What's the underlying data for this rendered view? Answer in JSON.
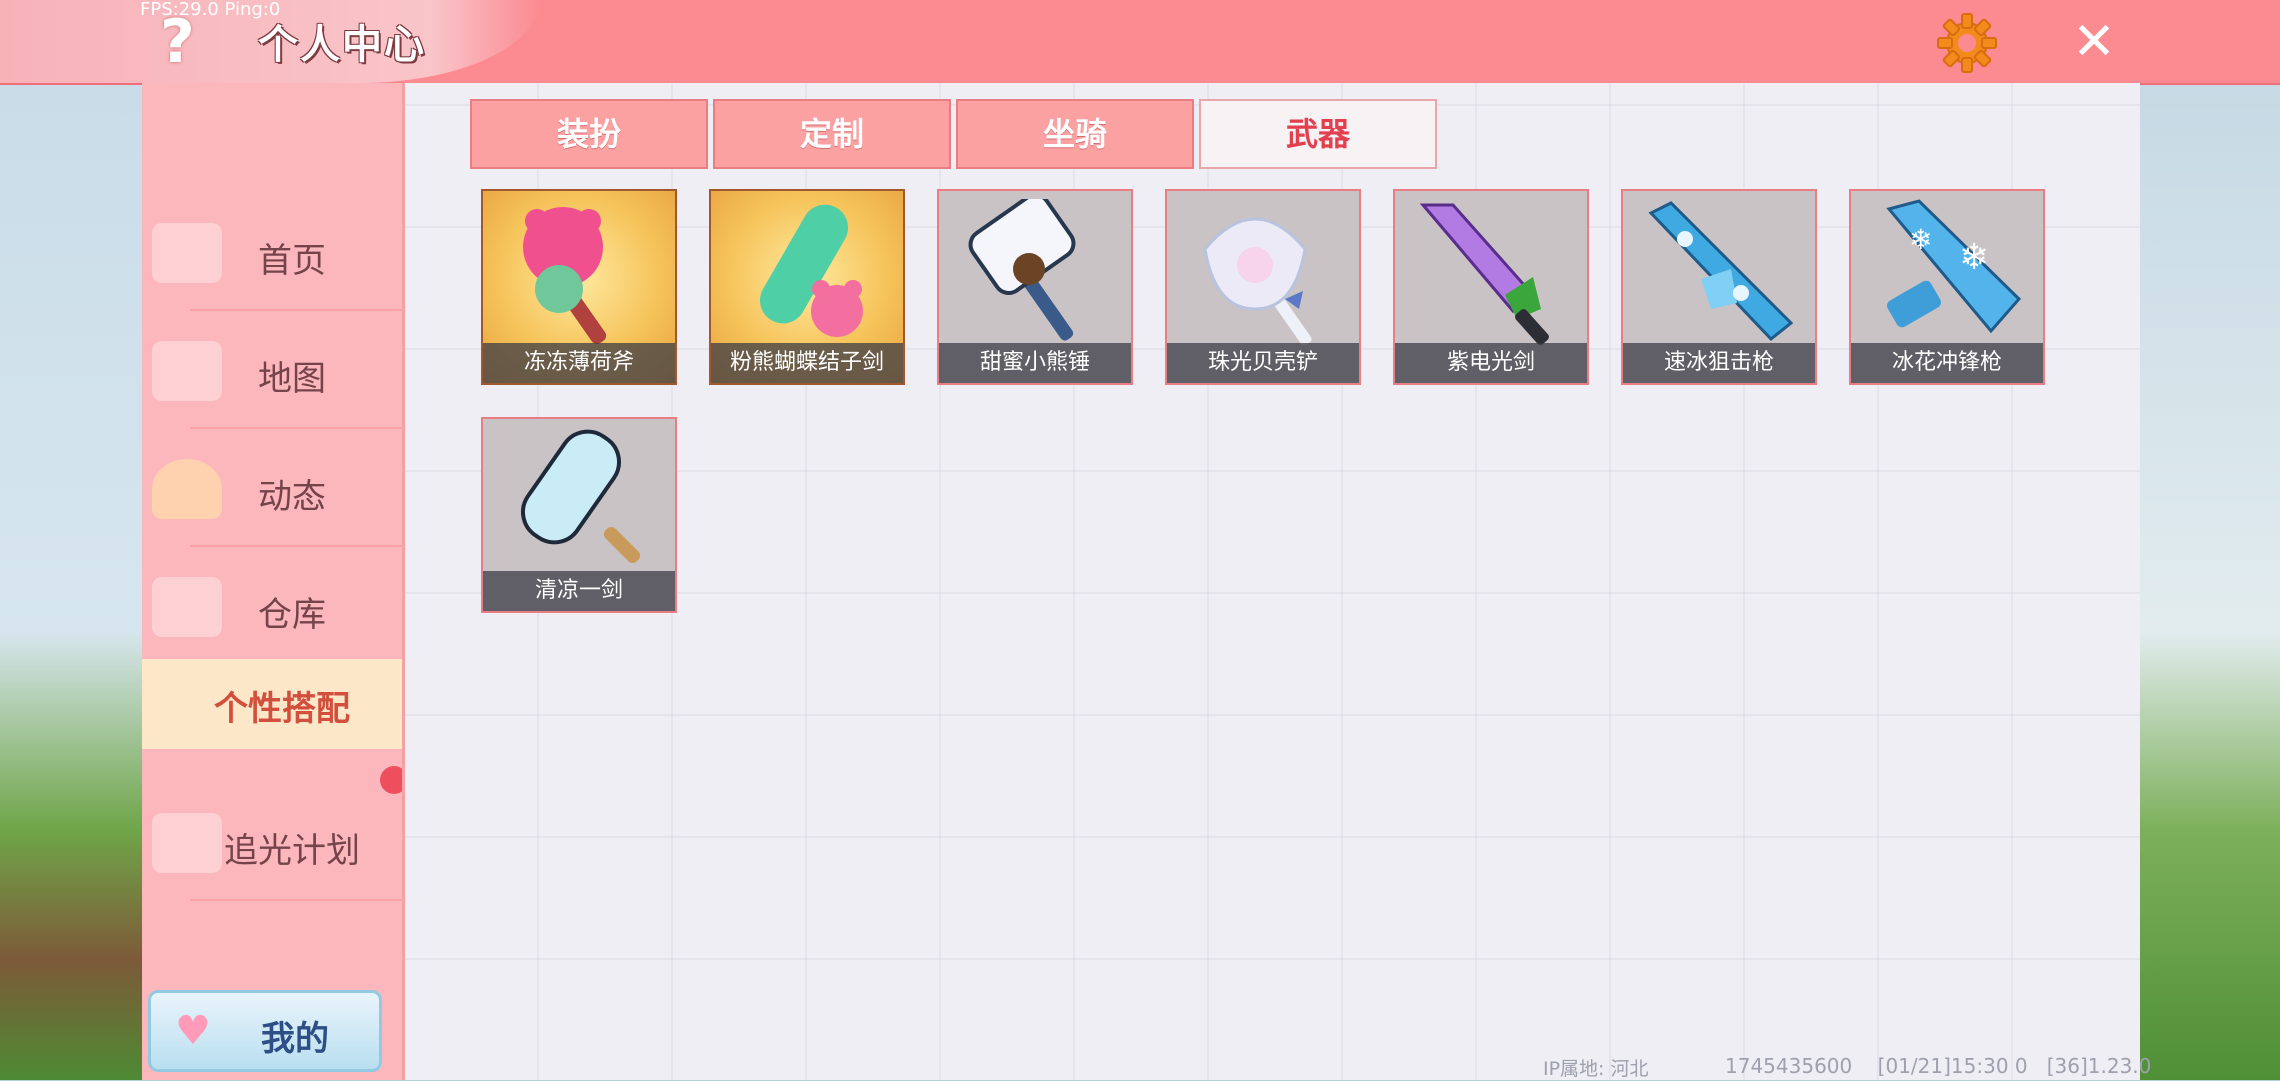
{
  "topbar": {
    "title": "个人中心",
    "fps_text": "FPS:29.0  Ping:0",
    "help_glyph": "?",
    "close_glyph": "✕"
  },
  "sidebar": {
    "items": [
      {
        "label": "首页",
        "icon": "home-icon"
      },
      {
        "label": "地图",
        "icon": "map-icon"
      },
      {
        "label": "动态",
        "icon": "bell-icon"
      },
      {
        "label": "仓库",
        "icon": "warehouse-icon"
      },
      {
        "label": "个性搭配",
        "icon": "",
        "active": true
      },
      {
        "label": "追光计划",
        "icon": "cake-icon"
      }
    ],
    "my_button": "我的"
  },
  "tabs": [
    {
      "label": "装扮"
    },
    {
      "label": "定制"
    },
    {
      "label": "坐骑"
    },
    {
      "label": "武器",
      "active": true
    }
  ],
  "weapons": [
    {
      "name": "冻冻薄荷斧",
      "rarity": "gold"
    },
    {
      "name": "粉熊蝴蝶结子剑",
      "rarity": "gold"
    },
    {
      "name": "甜蜜小熊锤",
      "rarity": "normal"
    },
    {
      "name": "珠光贝壳铲",
      "rarity": "normal"
    },
    {
      "name": "紫电光剑",
      "rarity": "normal"
    },
    {
      "name": "速冰狙击枪",
      "rarity": "normal"
    },
    {
      "name": "冰花冲锋枪",
      "rarity": "normal"
    },
    {
      "name": "清凉一剑",
      "rarity": "normal"
    }
  ],
  "footer": {
    "ip_label": "IP属地: 河北",
    "info": "1745435600    [01/21]15:30 0   [36]1.23.0"
  },
  "colors": {
    "topbar": "#fb8a91",
    "sidebar": "#fcb7bc",
    "active_tab_text": "#e23f4f",
    "panel_bg": "#efeef5"
  }
}
